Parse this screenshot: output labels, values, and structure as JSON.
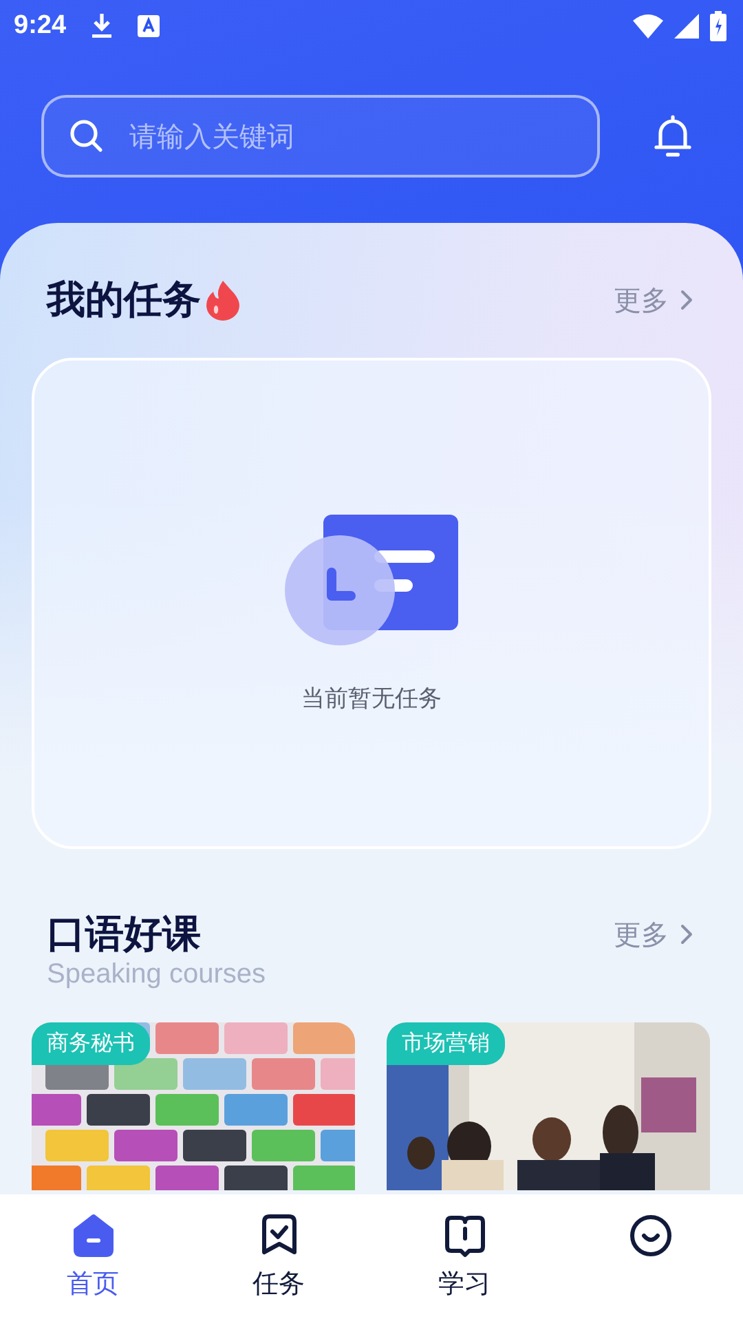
{
  "status_bar": {
    "time": "9:24"
  },
  "search": {
    "placeholder": "请输入关键词"
  },
  "tasks": {
    "title": "我的任务",
    "more": "更多",
    "empty_text": "当前暂无任务"
  },
  "courses": {
    "title": "口语好课",
    "subtitle": "Speaking courses",
    "more": "更多",
    "items": [
      {
        "tag": "商务秘书"
      },
      {
        "tag": "市场营销"
      }
    ]
  },
  "nav": [
    {
      "label": "首页",
      "selected": true
    },
    {
      "label": "任务",
      "selected": false
    },
    {
      "label": "学习",
      "selected": false
    },
    {
      "selected": false
    }
  ]
}
